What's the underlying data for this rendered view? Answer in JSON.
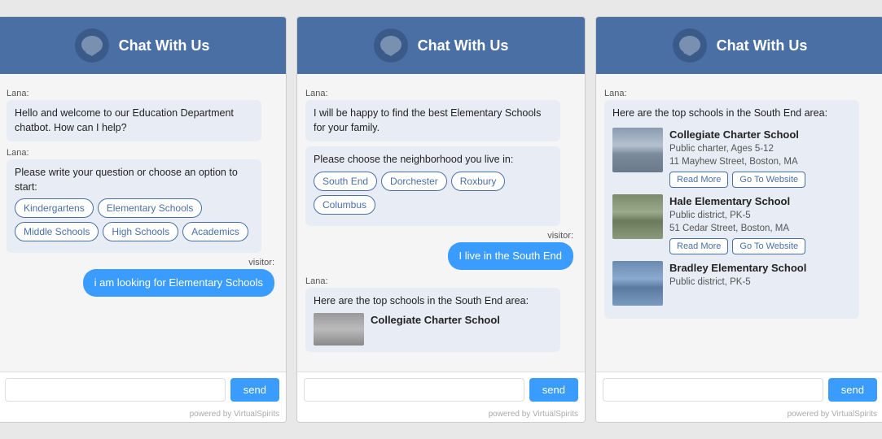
{
  "header": {
    "title": "Chat With Us"
  },
  "panel1": {
    "lana_greeting": "Lana:",
    "bubble1": "Hello and welcome to our Education Department chatbot. How can I help?",
    "lana_prompt": "Lana:",
    "bubble2": "Please write your question or choose an option to start:",
    "options": [
      "Kindergartens",
      "Elementary Schools",
      "Middle Schools",
      "High Schools",
      "Academics"
    ],
    "visitor_label": "visitor:",
    "user_message": "i am looking for Elementary Schools",
    "input_placeholder": "",
    "send_label": "send",
    "powered": "powered by VirtualSpirits"
  },
  "panel2": {
    "lana_label": "Lana:",
    "bubble1": "I will be happy to find the best Elementary Schools for your family.",
    "bubble2": "Please choose the neighborhood you live in:",
    "neighborhood_options": [
      "South End",
      "Dorchester",
      "Roxbury",
      "Columbus"
    ],
    "visitor_label": "visitor:",
    "user_message": "I live in the South End",
    "lana_label2": "Lana:",
    "bubble3_part1": "Here are the top schools in the South End area:",
    "school_name": "Collegiate Charter School",
    "send_label": "send",
    "powered": "powered by VirtualSpirits"
  },
  "panel3": {
    "lana_label": "Lana:",
    "bubble1_part1": "Here are the top schools in the South End area:",
    "schools": [
      {
        "name": "Collegiate Charter School",
        "type": "Public charter, Ages 5-12",
        "address": "11 Mayhew Street, Boston, MA",
        "read_more": "Read More",
        "go_to_website": "Go To Website",
        "img_class": "img-collegiate"
      },
      {
        "name": "Hale Elementary School",
        "type": "Public district, PK-5",
        "address": "51 Cedar Street, Boston, MA",
        "read_more": "Read More",
        "go_to_website": "Go To Website",
        "img_class": "img-hale"
      },
      {
        "name": "Bradley Elementary School",
        "type": "Public district, PK-5",
        "address": "",
        "read_more": "",
        "go_to_website": "",
        "img_class": "img-bradley"
      }
    ],
    "send_label": "send",
    "powered": "powered by VirtualSpirits"
  }
}
